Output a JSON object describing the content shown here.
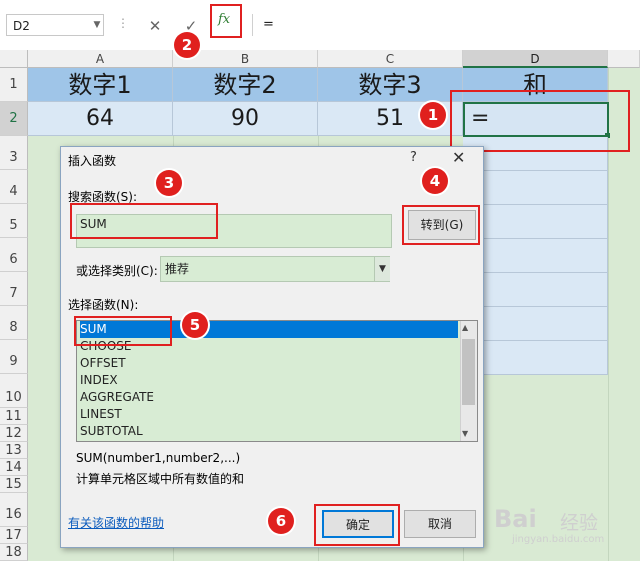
{
  "formula_bar": {
    "name_box": "D2",
    "cancel_icon": "✕",
    "enter_icon": "✓",
    "fx_label": "fx",
    "formula_value": "="
  },
  "columns": [
    "A",
    "B",
    "C",
    "D"
  ],
  "rows": [
    "1",
    "2",
    "3",
    "4",
    "5",
    "6",
    "7",
    "8",
    "9",
    "10",
    "11",
    "12",
    "13",
    "14",
    "15",
    "16",
    "17",
    "18"
  ],
  "sheet": {
    "headers": [
      "数字1",
      "数字2",
      "数字3",
      "和"
    ],
    "row2": [
      "64",
      "90",
      "51",
      "="
    ]
  },
  "badges": [
    "1",
    "2",
    "3",
    "4",
    "5",
    "6"
  ],
  "dialog": {
    "title": "插入函数",
    "help": "?",
    "close": "✕",
    "search_label": "搜索函数(S):",
    "search_value": "SUM",
    "go_button": "转到(G)",
    "category_label": "或选择类别(C):",
    "category_value": "推荐",
    "list_label": "选择函数(N):",
    "functions": [
      "SUM",
      "CHOOSE",
      "OFFSET",
      "INDEX",
      "AGGREGATE",
      "LINEST",
      "SUBTOTAL"
    ],
    "signature": "SUM(number1,number2,...)",
    "description": "计算单元格区域中所有数值的和",
    "help_link": "有关该函数的帮助",
    "ok_button": "确定",
    "cancel_button": "取消"
  },
  "watermark": {
    "brand": "Bai",
    "brand2": "经验",
    "url": "jingyan.baidu.com"
  },
  "colors": {
    "accent_red": "#e0201e",
    "header_blue": "#9fc5e8",
    "cell_blue": "#dae8f5",
    "grid_green": "#d9ead3",
    "selection_blue": "#0078d7"
  }
}
